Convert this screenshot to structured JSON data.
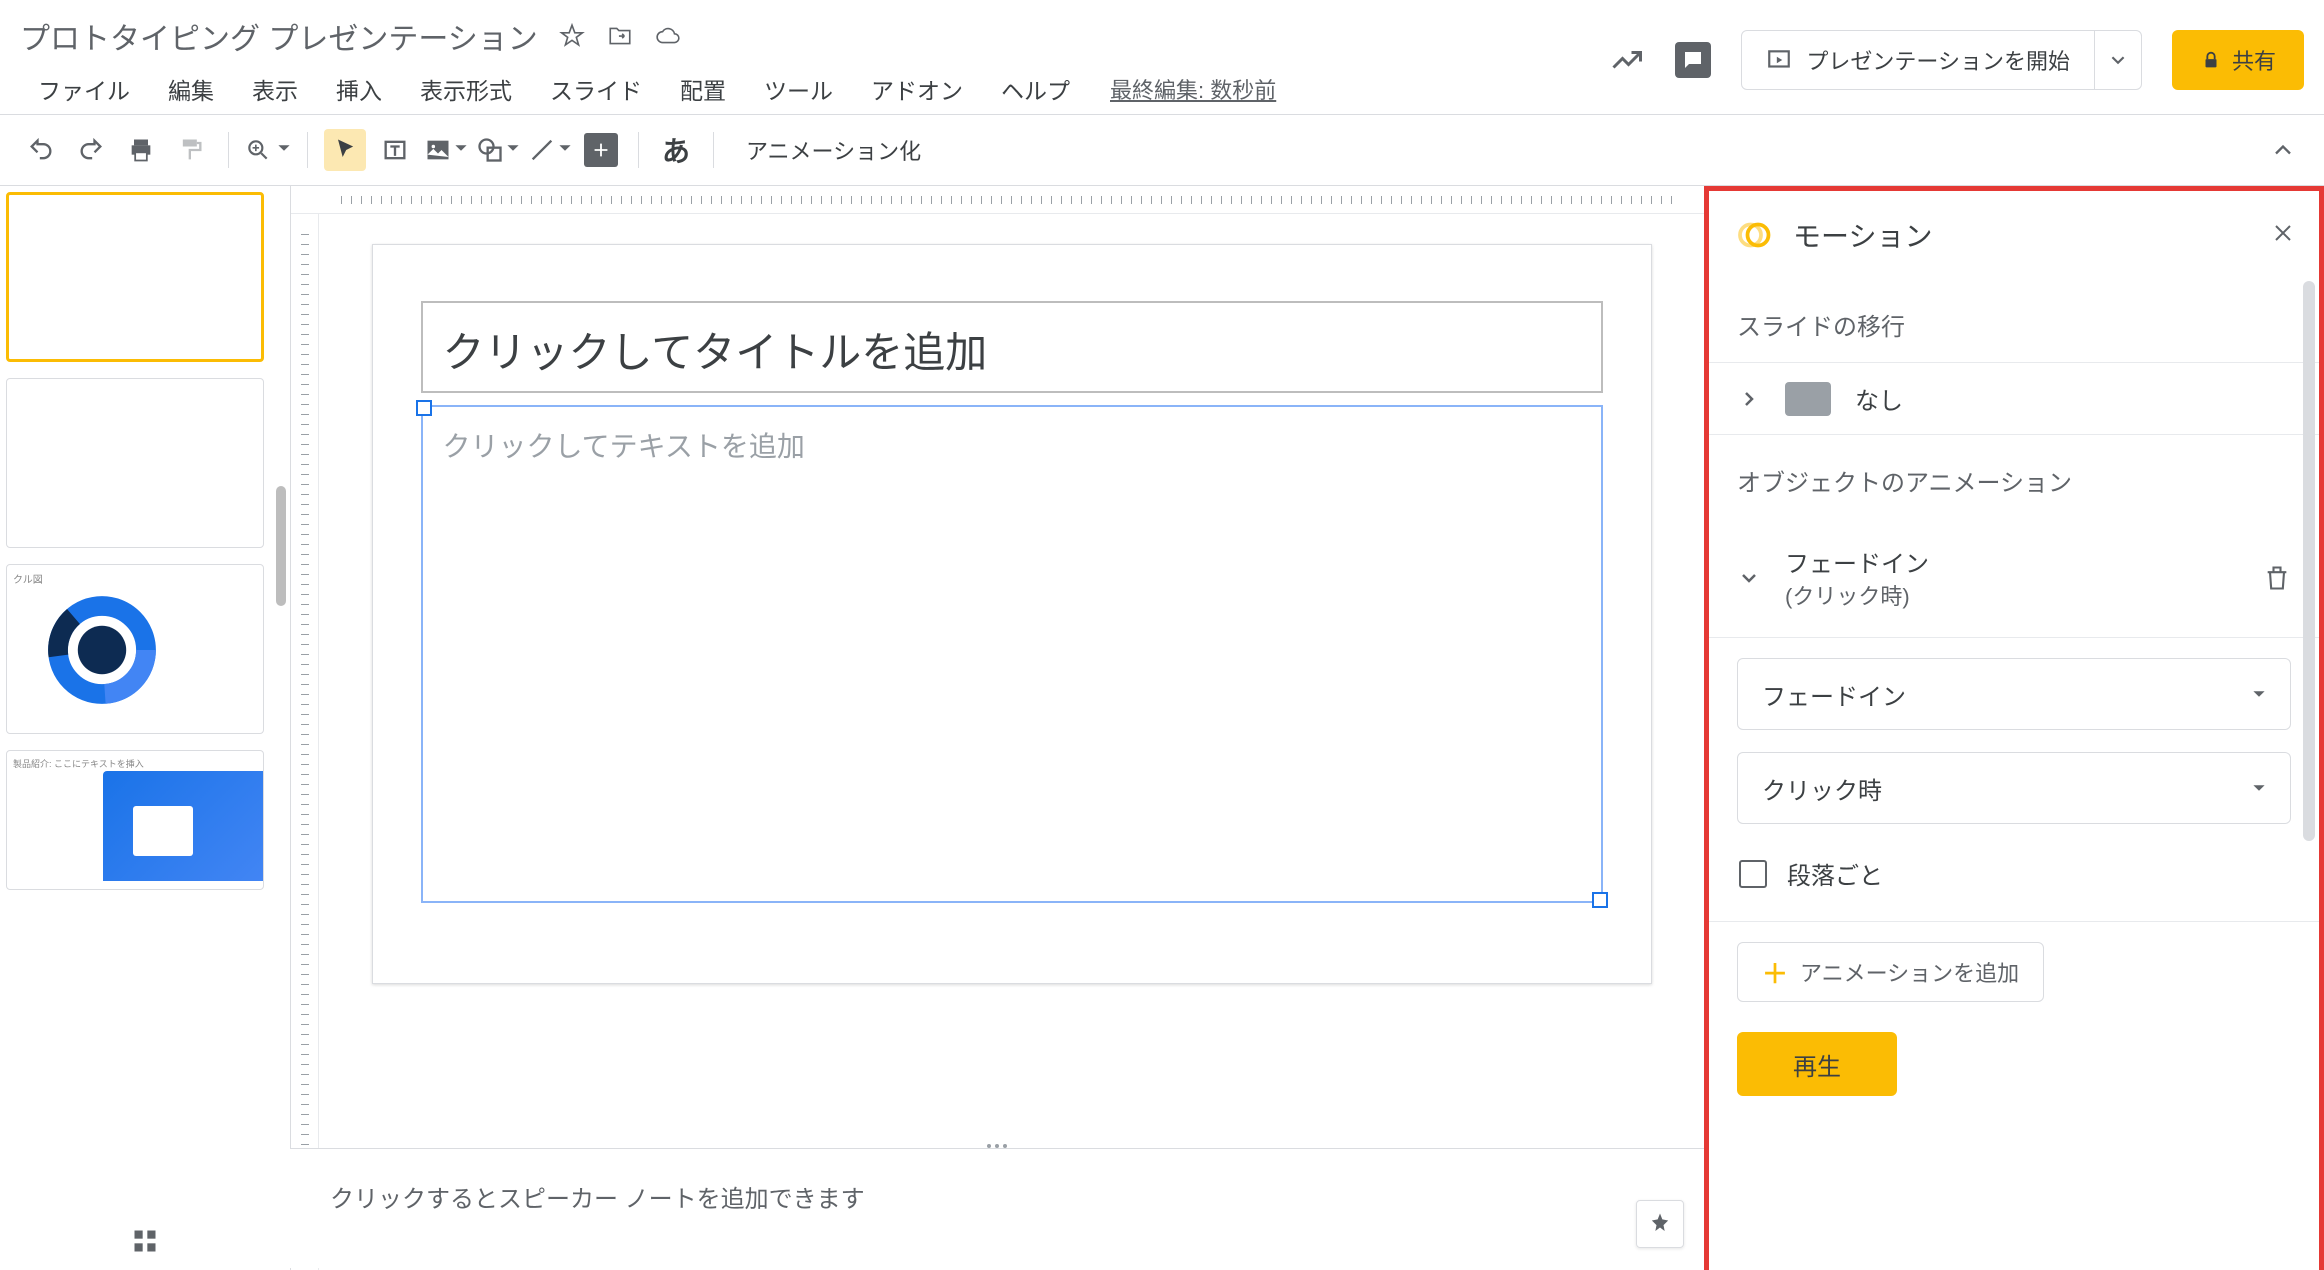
{
  "doc_title": "プロトタイピング プレゼンテーション",
  "menus": [
    "ファイル",
    "編集",
    "表示",
    "挿入",
    "表示形式",
    "スライド",
    "配置",
    "ツール",
    "アドオン",
    "ヘルプ"
  ],
  "last_edit": "最終編集: 数秒前",
  "present_label": "プレゼンテーションを開始",
  "share_label": "共有",
  "toolbar": {
    "animate_label": "アニメーション化",
    "ja_char": "あ"
  },
  "slide": {
    "title_placeholder": "クリックしてタイトルを追加",
    "body_placeholder": "クリックしてテキストを追加"
  },
  "notes_placeholder": "クリックするとスピーカー ノートを追加できます",
  "motion": {
    "title": "モーション",
    "section_transition": "スライドの移行",
    "transition_value": "なし",
    "section_object": "オブジェクトのアニメーション",
    "anim_name": "フェードイン",
    "anim_trigger_sub": "(クリック時)",
    "select_type": "フェードイン",
    "select_trigger": "クリック時",
    "by_paragraph": "段落ごと",
    "add_animation": "アニメーションを追加",
    "play": "再生"
  },
  "thumbs": {
    "cycle_label": "クル図",
    "product_label": "製品紹介: ここにテキストを挿入"
  }
}
